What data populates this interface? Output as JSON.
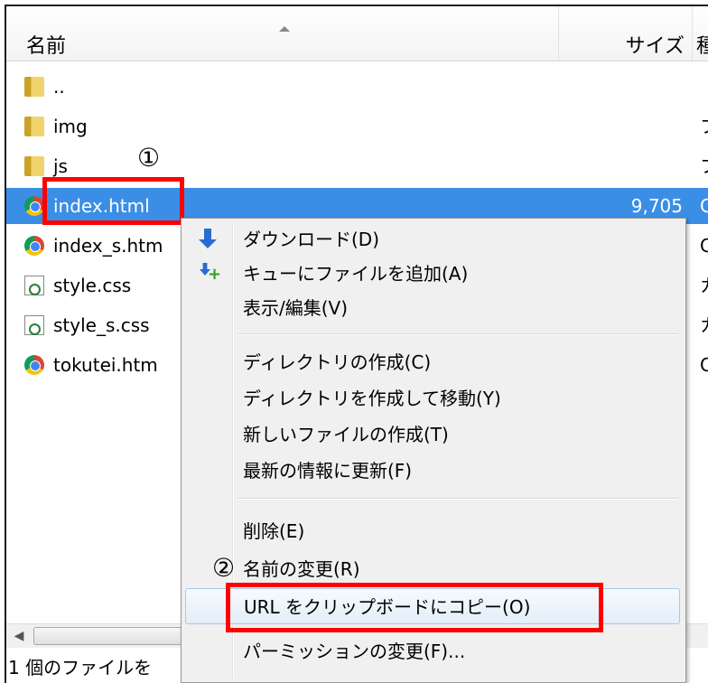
{
  "file_list": {
    "columns": {
      "name": "名前",
      "size": "サイズ",
      "type": "種"
    },
    "rows": [
      {
        "name": "..",
        "icon": "folder-icon",
        "size": "",
        "type": ""
      },
      {
        "name": "img",
        "icon": "folder-icon",
        "size": "",
        "type": "フ"
      },
      {
        "name": "js",
        "icon": "folder-icon",
        "size": "",
        "type": "フ"
      },
      {
        "name": "index.html",
        "icon": "chrome-icon",
        "size": "9,705",
        "type": "C",
        "selected": true
      },
      {
        "name": "index_s.htm",
        "icon": "chrome-icon",
        "size": "",
        "type": "C"
      },
      {
        "name": "style.css",
        "icon": "css-file-icon",
        "size": "",
        "type": "カ"
      },
      {
        "name": "style_s.css",
        "icon": "css-file-icon",
        "size": "",
        "type": "カ"
      },
      {
        "name": "tokutei.htm",
        "icon": "chrome-icon",
        "size": "",
        "type": "C"
      }
    ]
  },
  "annotations": {
    "marker_1": "①",
    "marker_2": "②",
    "color": "#ff0000"
  },
  "context_menu": {
    "items": [
      {
        "label": "ダウンロード(D)",
        "icon": "download-icon"
      },
      {
        "label": "キューにファイルを追加(A)",
        "icon": "add-to-queue-icon"
      },
      {
        "label": "表示/編集(V)"
      },
      {
        "label": "ディレクトリの作成(C)"
      },
      {
        "label": "ディレクトリを作成して移動(Y)"
      },
      {
        "label": "新しいファイルの作成(T)"
      },
      {
        "label": "最新の情報に更新(F)"
      },
      {
        "label": "削除(E)"
      },
      {
        "label": "名前の変更(R)"
      },
      {
        "label": "URL をクリップボードにコピー(O)",
        "highlighted": true
      },
      {
        "label": "パーミッションの変更(F)..."
      }
    ]
  },
  "status_bar": {
    "text": "1 個のファイルを"
  },
  "colors": {
    "selection": "#3a8ee6",
    "menu_background": "#f0f0f0"
  }
}
